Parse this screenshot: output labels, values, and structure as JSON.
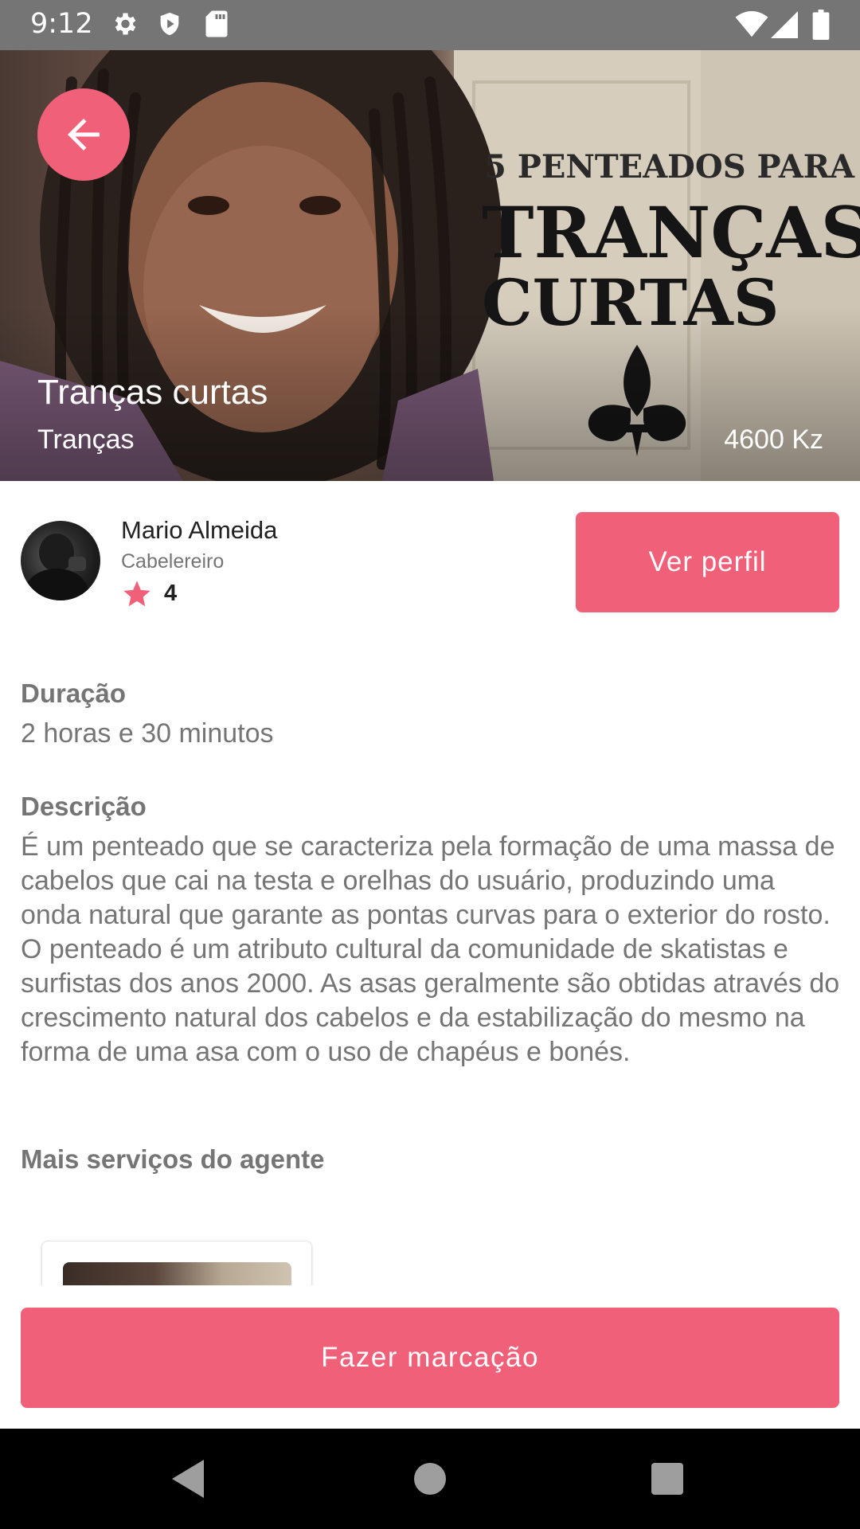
{
  "status_bar": {
    "time": "9:12",
    "left_icons": [
      "gear-icon",
      "shield-icon",
      "sd-card-icon"
    ],
    "right_icons": [
      "wifi-icon",
      "cell-signal-icon",
      "battery-icon"
    ]
  },
  "hero": {
    "image_text": {
      "line1": "5 PENTEADOS PARA",
      "line2": "TRANÇAS",
      "line3": "CURTAS"
    },
    "title": "Tranças curtas",
    "category": "Tranças",
    "price": "4600 Kz"
  },
  "agent": {
    "name": "Mario Almeida",
    "role": "Cabelereiro",
    "rating": "4",
    "profile_button_label": "Ver perfil"
  },
  "details": {
    "duration_label": "Duração",
    "duration_value": "2 horas e 30 minutos",
    "description_label": "Descrição",
    "description_text": "É um penteado que se caracteriza pela formação de uma massa de cabelos que cai na testa e orelhas do usuário, produzindo uma onda natural que garante as pontas curvas para o exterior do rosto. O penteado é um atributo cultural da comunidade de skatistas e surfistas dos anos 2000. As asas geralmente são obtidas através do crescimento natural dos cabelos e da estabilização do mesmo na forma de uma asa com o uso de chapéus e bonés.",
    "more_services_label": "Mais serviços do agente"
  },
  "actions": {
    "book_button_label": "Fazer marcação"
  },
  "colors": {
    "accent": "#f06079",
    "status_bar": "#757575",
    "muted_text": "#757575"
  }
}
